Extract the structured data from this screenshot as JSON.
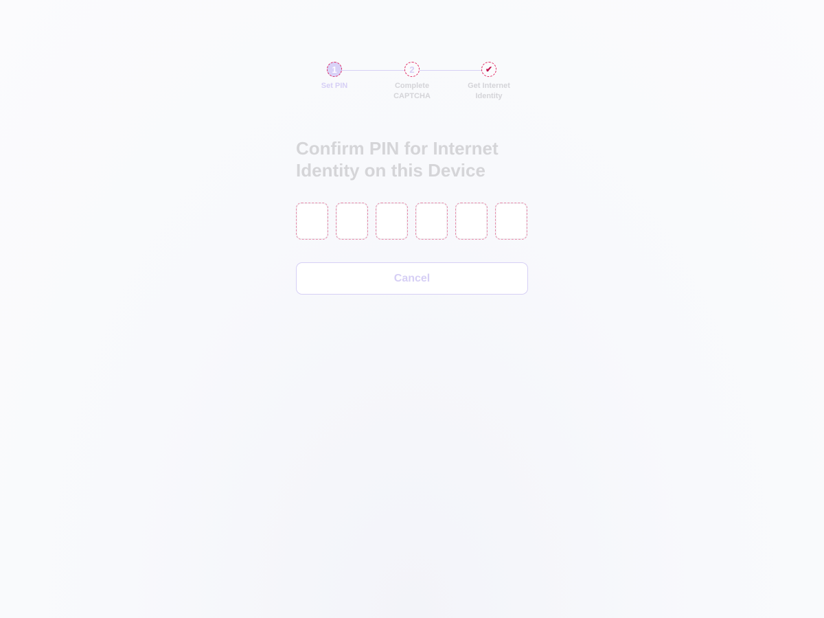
{
  "stepper": {
    "steps": [
      {
        "number": "1",
        "label": "Set PIN",
        "state": "active"
      },
      {
        "number": "2",
        "label": "Complete CAPTCHA",
        "state": "pending"
      },
      {
        "number": "✔",
        "label": "Get Internet Identity",
        "state": "pending"
      }
    ]
  },
  "main": {
    "title": "Confirm PIN for Internet Identity on this Device",
    "pin_values": [
      "",
      "",
      "",
      "",
      "",
      ""
    ],
    "cancel_label": "Cancel"
  },
  "colors": {
    "accent": "#d6cff5",
    "title": "#d5d5d8"
  }
}
